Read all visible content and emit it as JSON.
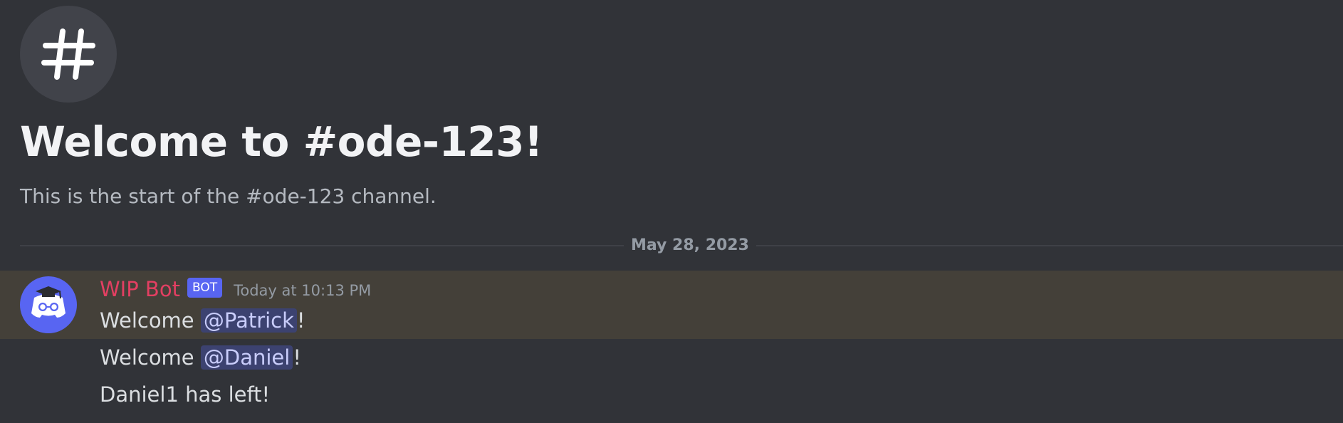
{
  "channel": {
    "icon": "hashtag-icon",
    "welcome_title": "Welcome to #ode-123!",
    "welcome_subtitle": "This is the start of the #ode-123 channel."
  },
  "divider": {
    "date": "May 28, 2023"
  },
  "message": {
    "avatar_icon": "discord-bot-avatar-icon",
    "username": "WIP Bot",
    "badge": "BOT",
    "timestamp": "Today at 10:13 PM",
    "lines": [
      {
        "prefix": "Welcome ",
        "mention": "@Patrick",
        "suffix": "!"
      },
      {
        "prefix": "Welcome ",
        "mention": "@Daniel",
        "suffix": "!"
      },
      {
        "text": "Daniel1 has left!"
      }
    ]
  },
  "colors": {
    "background": "#313338",
    "highlight": "#444039",
    "username": "#e33f62",
    "badge": "#5865f2",
    "mention_bg": "#3c4270",
    "mention_text": "#c9cdfb"
  }
}
